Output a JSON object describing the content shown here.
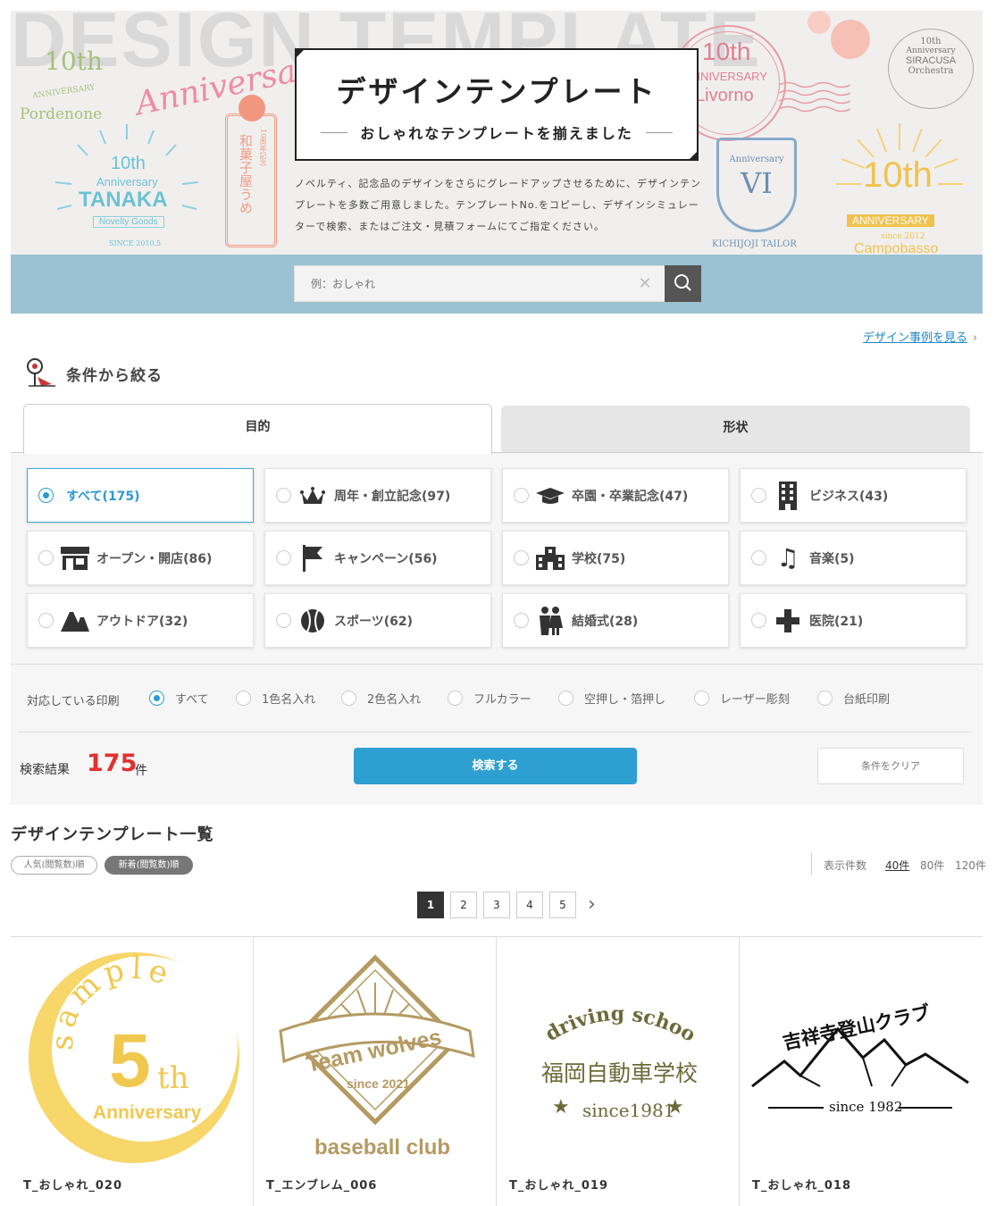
{
  "hero": {
    "background_word": "DESIGN TEMPLATE",
    "title": "デザインテンプレート",
    "subtitle": "おしゃれなテンプレートを揃えました",
    "description": "ノベルティ、記念品のデザインをさらにグレードアップさせるために、デザインテンプレートを多数ご用意しました。テンプレートNo.をコピーし、デザインシミュレーターで検索、またはご注文・見積フォームにてご指定ください。",
    "deco": {
      "pordenone": [
        "10th",
        "ANNIVERSARY",
        "Pordenone"
      ],
      "anniversary_script": "Anniversary",
      "tanaka": [
        "10th",
        "Anniversary",
        "TANAKA",
        "Novelty Goods",
        "SINCE 2010.5"
      ],
      "wagashi": [
        "10周年記念",
        "和菓子屋うめ"
      ],
      "livorno": [
        "10th",
        "ANNIVERSARY",
        "Livorno"
      ],
      "kichijoji": [
        "Anniversary",
        "VI",
        "KICHIJOJI TAILOR"
      ],
      "siracusa": [
        "10th",
        "Anniversary",
        "SIRACUSA",
        "Orchestra"
      ],
      "campobasso": [
        "10th",
        "ANNIVERSARY",
        "since 2012",
        "Campobasso"
      ]
    }
  },
  "search": {
    "placeholder": "例：おしゃれ",
    "clear_icon": "close-icon",
    "button_icon": "search-icon"
  },
  "link_cases": "デザイン事例を見る",
  "conditions": {
    "title": "条件から絞る",
    "tabs": [
      {
        "label": "目的",
        "active": true
      },
      {
        "label": "形状",
        "active": false
      }
    ],
    "purposes": [
      {
        "label": "すべて(175)",
        "selected": true,
        "icon": ""
      },
      {
        "label": "周年・創立記念(97)",
        "selected": false,
        "icon": "crown-icon"
      },
      {
        "label": "卒園・卒業記念(47)",
        "selected": false,
        "icon": "graduation-cap-icon"
      },
      {
        "label": "ビジネス(43)",
        "selected": false,
        "icon": "building-icon"
      },
      {
        "label": "オープン・開店(86)",
        "selected": false,
        "icon": "shop-icon"
      },
      {
        "label": "キャンペーン(56)",
        "selected": false,
        "icon": "flag-icon"
      },
      {
        "label": "学校(75)",
        "selected": false,
        "icon": "school-icon"
      },
      {
        "label": "音楽(5)",
        "selected": false,
        "icon": "music-note-icon"
      },
      {
        "label": "アウトドア(32)",
        "selected": false,
        "icon": "mountain-icon"
      },
      {
        "label": "スポーツ(62)",
        "selected": false,
        "icon": "ball-icon"
      },
      {
        "label": "結婚式(28)",
        "selected": false,
        "icon": "couple-icon"
      },
      {
        "label": "医院(21)",
        "selected": false,
        "icon": "cross-icon"
      }
    ],
    "print_label": "対応している印刷",
    "print_options": [
      {
        "label": "すべて",
        "selected": true
      },
      {
        "label": "1色名入れ",
        "selected": false
      },
      {
        "label": "2色名入れ",
        "selected": false
      },
      {
        "label": "フルカラー",
        "selected": false
      },
      {
        "label": "空押し・箔押し",
        "selected": false
      },
      {
        "label": "レーザー彫刻",
        "selected": false
      },
      {
        "label": "台紙印刷",
        "selected": false
      }
    ],
    "result_label": "検索結果",
    "result_count": "175",
    "result_unit": "件",
    "search_button": "検索する",
    "clear_button": "条件をクリア"
  },
  "list": {
    "title": "デザインテンプレート一覧",
    "sort": [
      "人気(閲覧数)順",
      "新着(閲覧数)順"
    ],
    "per_page_label": "表示件数",
    "per_page": [
      "40件",
      "80件",
      "120件"
    ],
    "pages": [
      "1",
      "2",
      "3",
      "4",
      "5"
    ],
    "current_page": "1",
    "cards": [
      {
        "code": "T_おしゃれ_020",
        "art": [
          "sample",
          "5",
          "th",
          "Anniversary"
        ]
      },
      {
        "code": "T_エンブレム_006",
        "art": [
          "Team wolves",
          "since 2021",
          "baseball club"
        ]
      },
      {
        "code": "T_おしゃれ_019",
        "art": [
          "driving school",
          "福岡自動車学校",
          "since1981"
        ]
      },
      {
        "code": "T_おしゃれ_018",
        "art": [
          "吉祥寺登山クラブ",
          "since 1982"
        ]
      }
    ]
  },
  "colors": {
    "accent": "#2e9fd1",
    "search_band": "#9bc2d2",
    "result_red": "#e03131",
    "gold": "#f7d66a",
    "emblem_gold": "#b59a62",
    "olive": "#6b6b3a"
  }
}
